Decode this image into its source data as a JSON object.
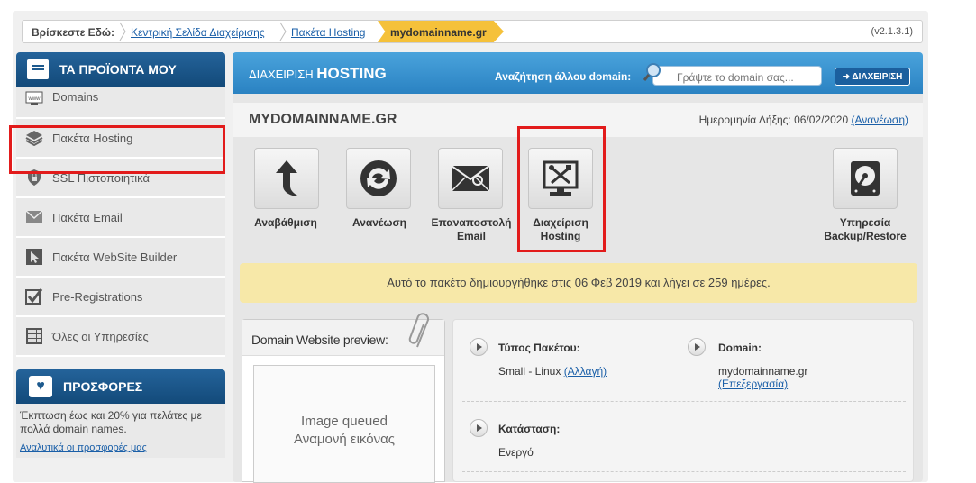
{
  "breadcrumb": {
    "here_label": "Βρίσκεστε Εδώ:",
    "items": [
      "Κεντρική Σελίδα Διαχείρισης",
      "Πακέτα Hosting"
    ],
    "active": "mydomainname.gr",
    "version": "(v2.1.3.1)"
  },
  "sidebar": {
    "header": "ΤΑ ΠΡΟΪΟΝΤΑ ΜΟΥ",
    "items": [
      {
        "label": "Domains",
        "icon": "www-icon"
      },
      {
        "label": "Πακέτα Hosting",
        "icon": "layers-icon"
      },
      {
        "label": "SSL Πιστοποιητικά",
        "icon": "lock-icon"
      },
      {
        "label": "Πακέτα Email",
        "icon": "email-icon"
      },
      {
        "label": "Πακέτα WebSite Builder",
        "icon": "cursor-icon"
      },
      {
        "label": "Pre-Registrations",
        "icon": "checkbox-icon"
      },
      {
        "label": "Όλες οι Υπηρεσίες",
        "icon": "grid-icon"
      }
    ],
    "offers": {
      "header": "ΠΡΟΣΦΟΡΕΣ",
      "text": "Έκπτωση έως και 20% για πελάτες με πολλά domain names.",
      "link": "Αναλυτικά οι προσφορές μας"
    }
  },
  "main": {
    "title_prefix": "ΔΙΑΧΕΙΡΙΣΗ",
    "title_main": "HOSTING",
    "search_label": "Αναζήτηση άλλου domain:",
    "search_placeholder": "Γράψτε το domain σας...",
    "manage_button": "➜ ΔΙΑΧΕΙΡΙΣΗ",
    "domain": "MYDOMAINNAME.GR",
    "expiry_label": "Ημερομηνία Λήξης: 06/02/2020",
    "renew_link": "(Ανανέωση)",
    "actions": [
      {
        "label": "Αναβάθμιση",
        "icon": "upgrade-arrow-icon"
      },
      {
        "label": "Ανανέωση",
        "icon": "refresh-icon"
      },
      {
        "label_1": "Επαναποστολή",
        "label_2": "Email",
        "icon": "resend-email-icon"
      },
      {
        "label_1": "Διαχείριση",
        "label_2": "Hosting",
        "icon": "tools-monitor-icon"
      },
      {
        "label_1": "Υπηρεσία",
        "label_2": "Backup/Restore",
        "icon": "hard-drive-icon"
      }
    ],
    "notice": "Αυτό το πακέτο δημιουργήθηκε στις 06 Φεβ 2019 και λήγει σε 259 ημέρες.",
    "preview": {
      "title": "Domain Website preview:",
      "line1": "Image queued",
      "line2": "Αναμονή εικόνας"
    },
    "info": {
      "type_label": "Τύπος Πακέτου:",
      "type_value": "Small - Linux",
      "type_link": "(Αλλαγή)",
      "domain_label": "Domain:",
      "domain_value": "mydomainname.gr",
      "domain_link": "(Επεξεργασία)",
      "status_label": "Κατάσταση:",
      "status_value": "Ενεργό"
    }
  },
  "colors": {
    "accent_blue": "#2a82c2",
    "sidebar_blue": "#1d5a8e",
    "breadcrumb_active": "#f5c13a",
    "notice_bg": "#f7e8a8",
    "highlight_red": "#e21b1b"
  }
}
